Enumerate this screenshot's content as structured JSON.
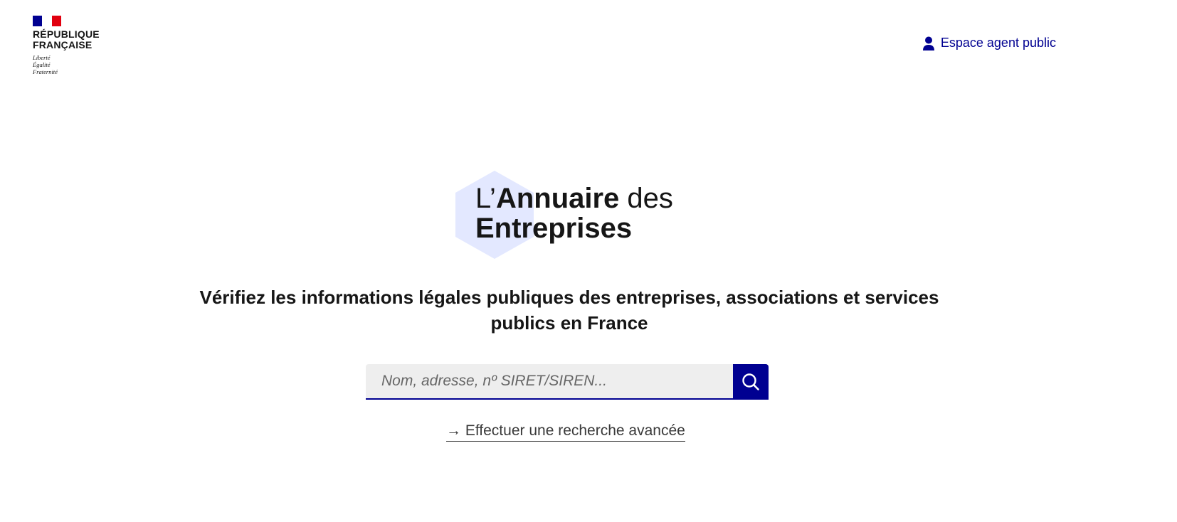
{
  "header": {
    "brand": {
      "line1": "RÉPUBLIQUE",
      "line2": "FRANÇAISE",
      "motto": [
        "Liberté",
        "Égalité",
        "Fraternité"
      ]
    },
    "agent_link": {
      "label": "Espace agent public",
      "icon": "user-icon"
    }
  },
  "hero": {
    "logo": {
      "prefix": "L’",
      "bold1": "Annuaire",
      "light1": " des",
      "bold2": "Entreprises"
    },
    "tagline": "Vérifiez les informations légales publiques des entreprises, associations et services publics en France",
    "search": {
      "placeholder": "Nom, adresse, nº SIRET/SIREN...",
      "value": "",
      "button_icon": "search-icon"
    },
    "advanced_link": "→ Effectuer une recherche avancée"
  },
  "colors": {
    "brand_blue": "#000091",
    "brand_red": "#e1000f",
    "hexagon_fill": "#e3e8ff",
    "input_bg": "#eeeeee",
    "text": "#161616"
  }
}
